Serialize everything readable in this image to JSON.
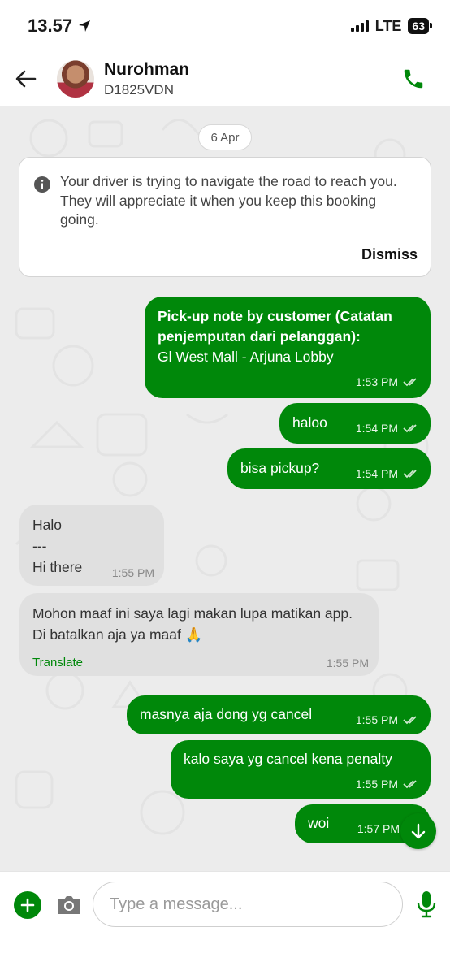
{
  "status_bar": {
    "time": "13.57",
    "network": "LTE",
    "battery": "63",
    "icons": [
      "location-arrow-icon",
      "signal-icon",
      "battery-icon"
    ]
  },
  "header": {
    "contact_name": "Nurohman",
    "plate": "D1825VDN",
    "icons": [
      "back-arrow-icon",
      "phone-icon"
    ],
    "accent_color": "#00880a"
  },
  "chat": {
    "date_chip": "6 Apr",
    "notice": {
      "text": "Your driver is trying to navigate the road to reach you. They will appreciate it when you keep this booking going.",
      "dismiss_label": "Dismiss",
      "icon": "info-icon"
    },
    "messages": [
      {
        "direction": "out",
        "title": "Pick-up note by customer (Catatan penjemputan dari pelanggan):",
        "text": "Gl West Mall - Arjuna Lobby",
        "time": "1:53 PM",
        "read": true
      },
      {
        "direction": "out",
        "text": "haloo",
        "time": "1:54 PM",
        "read": true
      },
      {
        "direction": "out",
        "text": "bisa pickup?",
        "time": "1:54 PM",
        "read": true
      },
      {
        "direction": "in",
        "text_lines": [
          "Halo",
          "---",
          "Hi there"
        ],
        "time": "1:55 PM"
      },
      {
        "direction": "in",
        "text": "Mohon maaf ini saya lagi makan lupa matikan app. Di batalkan aja ya maaf 🙏",
        "translate_label": "Translate",
        "time": "1:55 PM"
      },
      {
        "direction": "out",
        "text": "masnya aja dong yg cancel",
        "time": "1:55 PM",
        "read": true
      },
      {
        "direction": "out",
        "text": "kalo saya yg cancel kena penalty",
        "time": "1:55 PM",
        "read": true
      },
      {
        "direction": "out",
        "text": "woi",
        "time": "1:57 PM",
        "read": true
      }
    ]
  },
  "composer": {
    "placeholder": "Type a message...",
    "icons": [
      "plus-icon",
      "camera-icon",
      "microphone-icon",
      "arrow-down-icon"
    ]
  }
}
